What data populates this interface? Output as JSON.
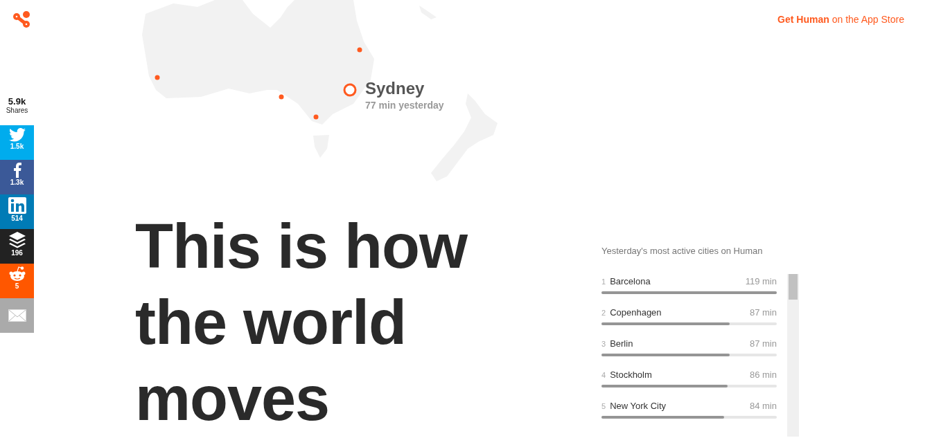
{
  "app_store_link": {
    "bold": "Get Human",
    "rest": "on the App Store"
  },
  "shares": {
    "total": "5.9k",
    "label": "Shares"
  },
  "share_buttons": [
    {
      "kind": "twitter",
      "count": "1.5k"
    },
    {
      "kind": "facebook",
      "count": "1.3k"
    },
    {
      "kind": "linkedin",
      "count": "514"
    },
    {
      "kind": "buffer",
      "count": "196"
    },
    {
      "kind": "reddit",
      "count": "5"
    },
    {
      "kind": "email"
    }
  ],
  "map_callout": {
    "city": "Sydney",
    "detail": "77 min yesterday"
  },
  "headline": [
    "This is how",
    "the world",
    "moves"
  ],
  "cities_panel": {
    "title": "Yesterday's most active cities on Human",
    "cities": [
      {
        "rank": "1",
        "name": "Barcelona",
        "time": "119 min",
        "level": 1
      },
      {
        "rank": "2",
        "name": "Copenhagen",
        "time": "87 min",
        "level": 0.73
      },
      {
        "rank": "3",
        "name": "Berlin",
        "time": "87 min",
        "level": 0.73
      },
      {
        "rank": "4",
        "name": "Stockholm",
        "time": "86 min",
        "level": 0.72
      },
      {
        "rank": "5",
        "name": "New York City",
        "time": "84 min",
        "level": 0.7
      }
    ]
  }
}
